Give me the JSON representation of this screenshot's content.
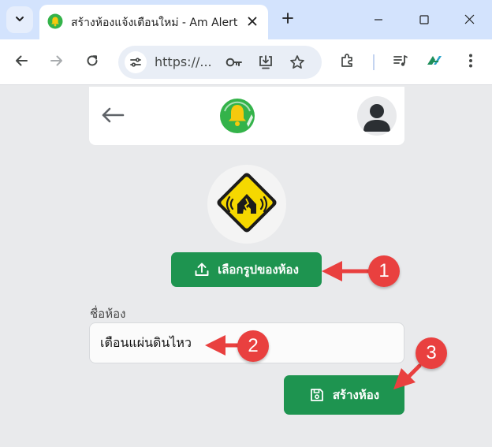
{
  "browser": {
    "tab_title": "สร้างห้องแจ้งเตือนใหม่ - Am Alert",
    "url_display": "https://...",
    "favicon": "am-alert-bell-logo",
    "icons": [
      "tab-list-icon",
      "close-icon",
      "plus-icon",
      "minimize-icon",
      "maximize-icon",
      "close-window-icon",
      "back-icon",
      "forward-icon",
      "reload-icon",
      "site-settings-icon",
      "password-key-icon",
      "install-app-icon",
      "star-icon",
      "extensions-icon",
      "media-queue-icon",
      "app-extension-icon",
      "more-icon"
    ]
  },
  "page": {
    "header": {
      "back_icon": "arrow-left-icon",
      "logo": "am-alert-logo",
      "avatar": "user-avatar-icon"
    },
    "room_image": {
      "icon": "earthquake-warning-sign",
      "sign_color": "#f5d800"
    },
    "choose_image_button": {
      "label": "เลือกรูปของห้อง",
      "icon": "upload-icon"
    },
    "room_name": {
      "label": "ชื่อห้อง",
      "value": "เตือนแผ่นดินไหว"
    },
    "create_button": {
      "label": "สร้างห้อง",
      "icon": "save-icon"
    },
    "annotations": [
      "1",
      "2",
      "3"
    ],
    "colors": {
      "primary": "#1e9450",
      "annotation": "#e9403f",
      "background": "#e9eaec"
    }
  }
}
